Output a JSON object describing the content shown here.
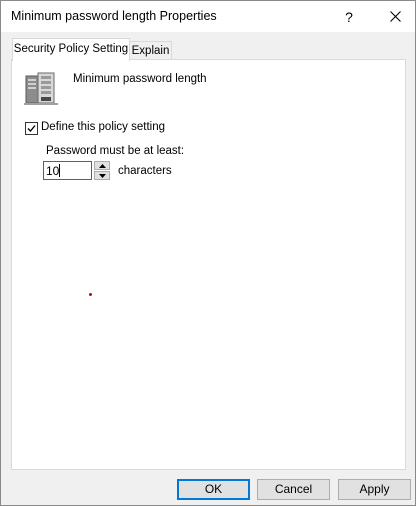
{
  "window": {
    "title": "Minimum password length Properties",
    "help_label": "?"
  },
  "tabs": [
    {
      "label": "Security Policy Setting"
    },
    {
      "label": "Explain"
    }
  ],
  "policy": {
    "icon": "server-icon",
    "name": "Minimum password length",
    "define_checkbox": {
      "label": "Define this policy setting",
      "checked": true
    },
    "field_label": "Password must be at least:",
    "value": "10",
    "unit": "characters"
  },
  "buttons": {
    "ok": "OK",
    "cancel": "Cancel",
    "apply": "Apply"
  },
  "colors": {
    "accent": "#0078d7",
    "marker": "#d40000"
  }
}
